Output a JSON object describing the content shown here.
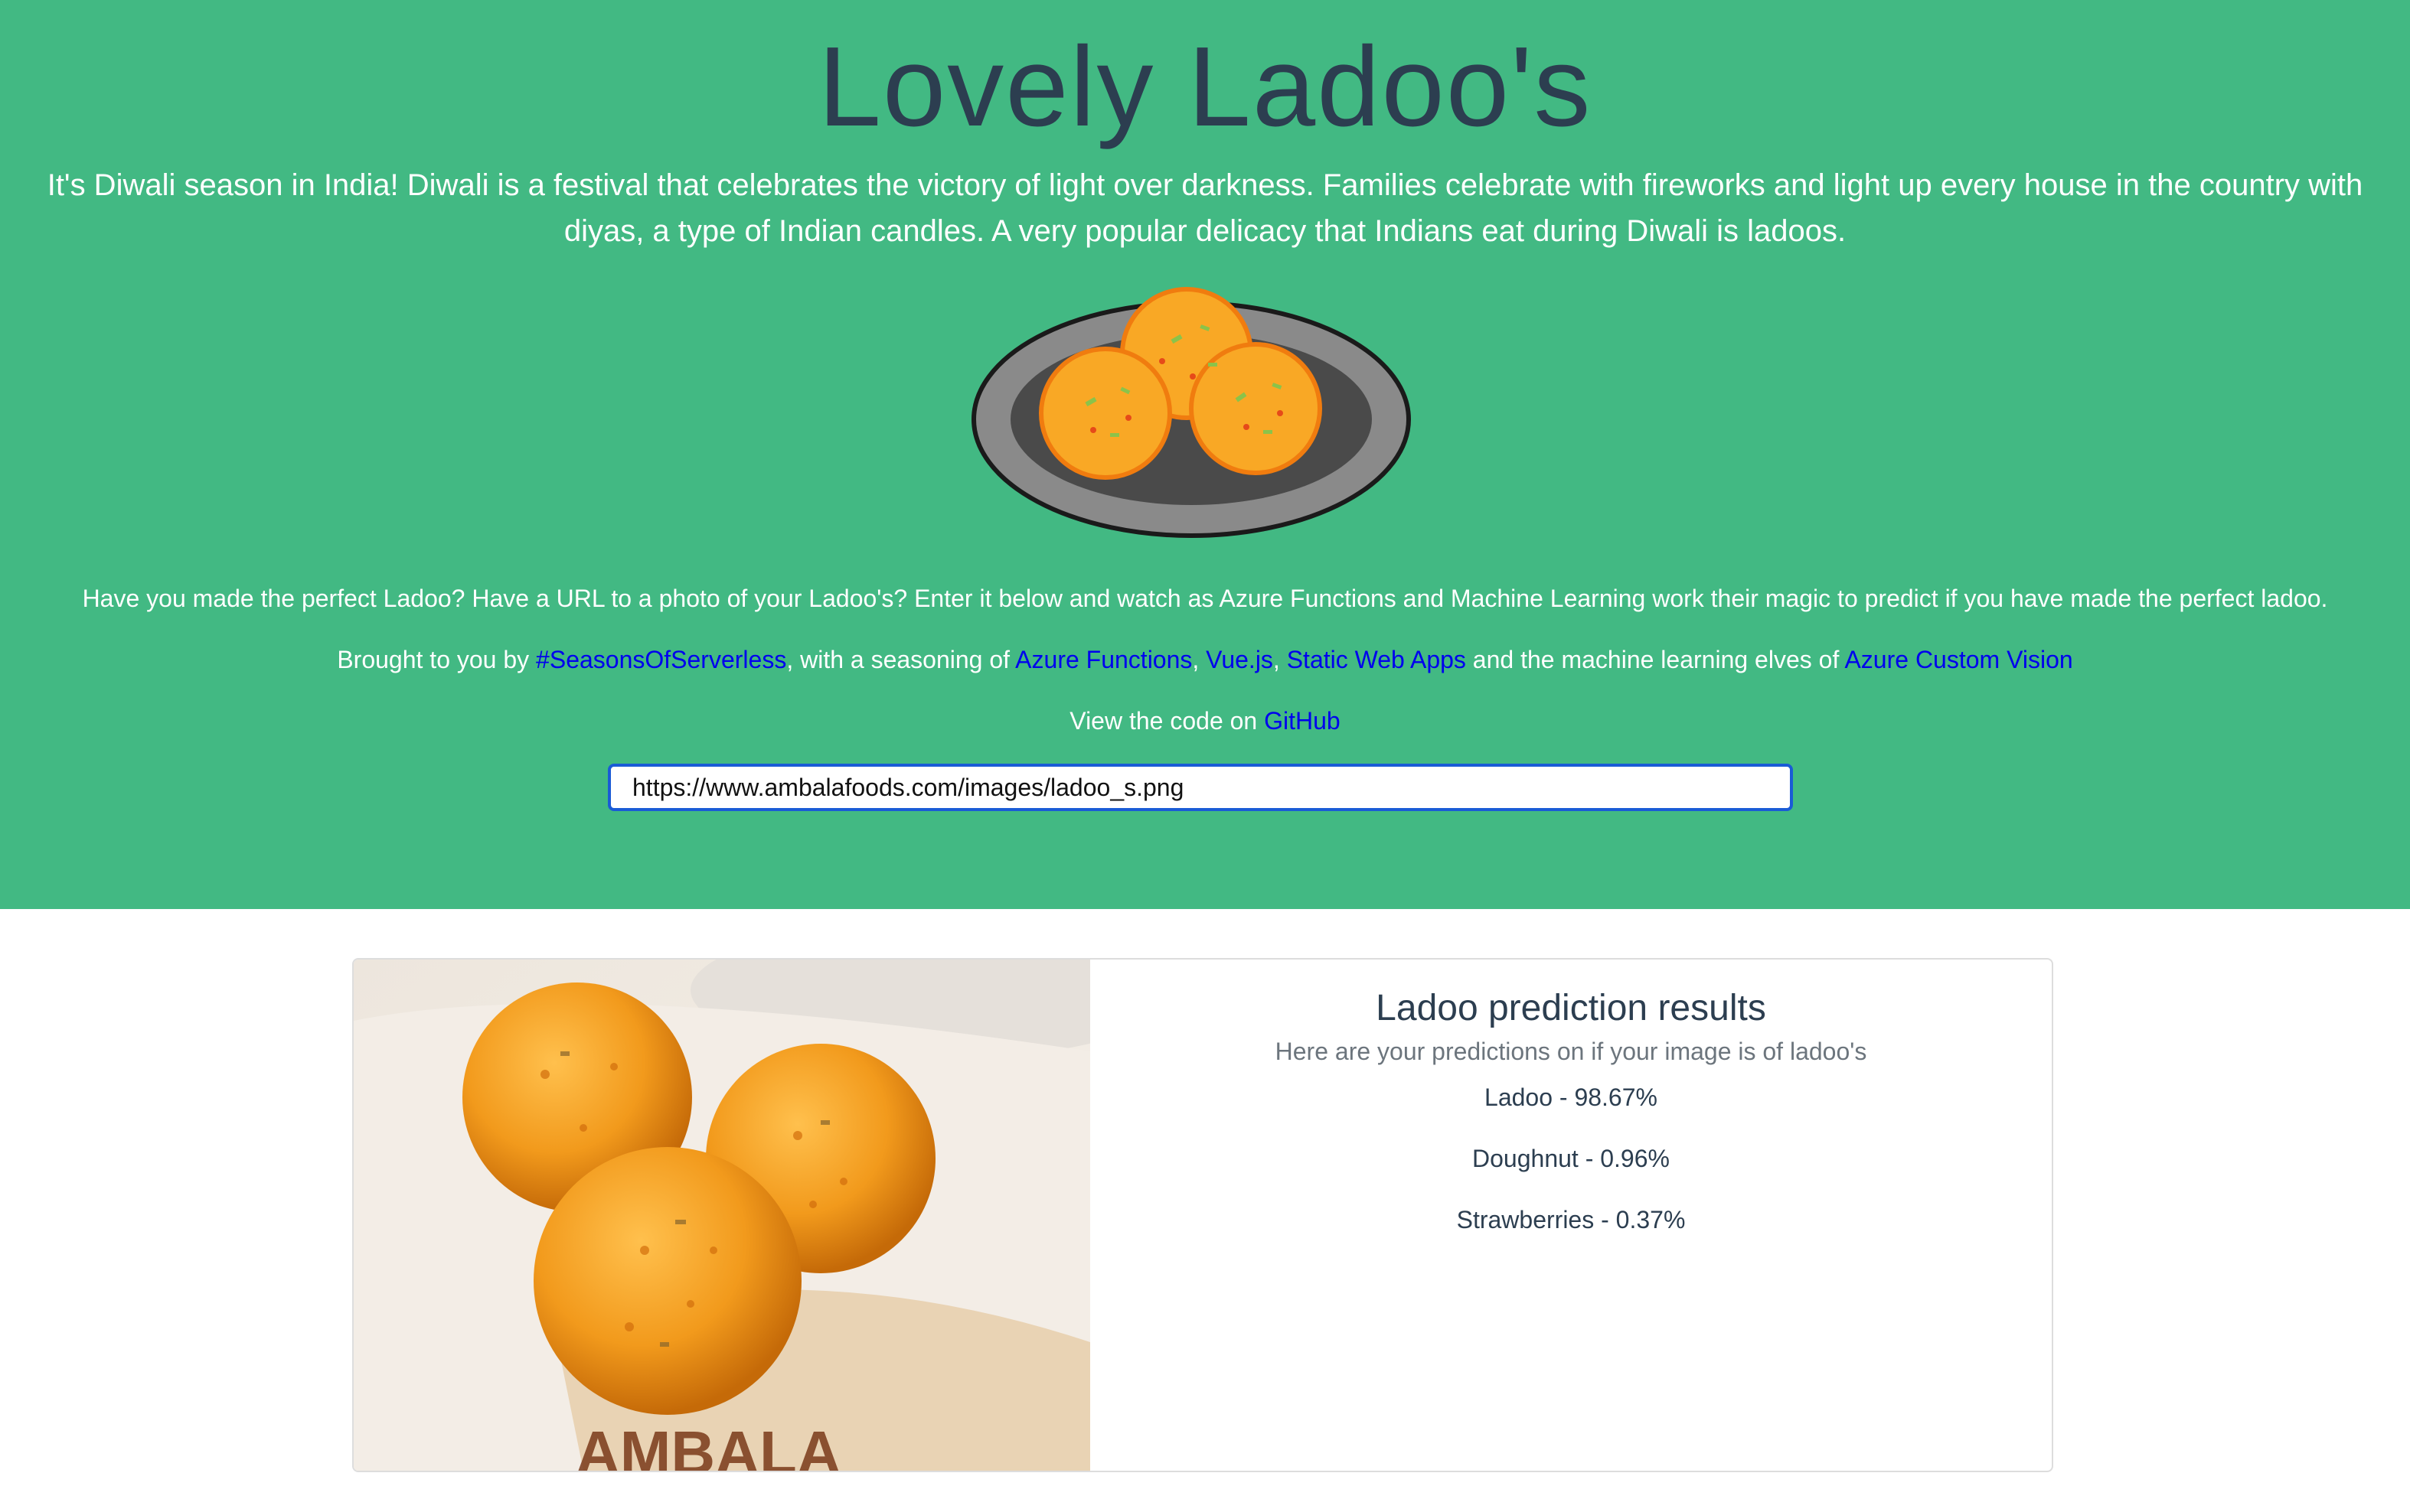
{
  "hero": {
    "title": "Lovely Ladoo's",
    "intro": "It's Diwali season in India! Diwali is a festival that celebrates the victory of light over darkness. Families celebrate with fireworks and light up every house in the country with diyas, a type of Indian candles. A very popular delicacy that Indians eat during Diwali is ladoos.",
    "prompt": "Have you made the perfect Ladoo? Have a URL to a photo of your Ladoo's? Enter it below and watch as Azure Functions and Machine Learning work their magic to predict if you have made the perfect ladoo.",
    "credits": {
      "prefix": "Brought to you by ",
      "link_seasons": "#SeasonsOfServerless",
      "mid1": ", with a seasoning of ",
      "link_functions": "Azure Functions",
      "sep1": ", ",
      "link_vue": "Vue.js",
      "sep2": ", ",
      "link_swa": "Static Web Apps",
      "mid2": " and the machine learning elves of ",
      "link_customvision": "Azure Custom Vision"
    },
    "github": {
      "prefix": "View the code on ",
      "link": "GitHub"
    },
    "url_input_value": "https://www.ambalafoods.com/images/ladoo_s.png"
  },
  "results": {
    "photo_brand": "AMBALA",
    "title": "Ladoo prediction results",
    "subtitle": "Here are your predictions on if your image is of ladoo's",
    "predictions": [
      {
        "text": "Ladoo - 98.67%"
      },
      {
        "text": "Doughnut - 0.96%"
      },
      {
        "text": "Strawberries - 0.37%"
      }
    ]
  },
  "colors": {
    "hero_bg": "#42b983",
    "title_text": "#2c3e50",
    "link": "#0000ee",
    "input_border": "#1a5bd6"
  }
}
